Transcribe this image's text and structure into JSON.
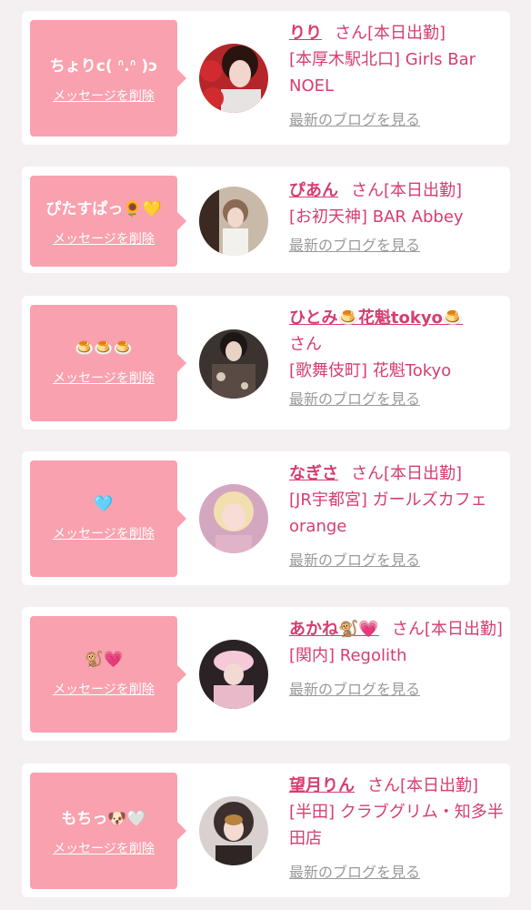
{
  "delete_label": "メッセージを削除",
  "blog_label": "最新のブログを見る",
  "san_label": "さん",
  "colors": {
    "background": "#f4f0f1",
    "bubble": "#f9a1ae",
    "accent": "#d63d72",
    "muted": "#9a9a9a"
  },
  "messages": [
    {
      "message": "ちょりc( ᐢ.ᐢ )ɔ",
      "name": "りり",
      "line1": "[本日出勤]",
      "line2": "[本厚木駅北口] Girls Bar NOEL",
      "avatar_icon": "woman-with-red-decoration-photo"
    },
    {
      "message": "ぴたすぱっ🌻💛",
      "name": "ぴあん",
      "line1": "[本日出勤]",
      "line2": "[お初天神] BAR Abbey",
      "avatar_icon": "woman-mirror-selfie-photo"
    },
    {
      "message": "🍮🍮🍮",
      "name": "ひとみ🍮花魁tokyo🍮",
      "line1": "",
      "line2": "[歌舞伎町] 花魁Tokyo",
      "avatar_icon": "woman-in-kimono-photo"
    },
    {
      "message": "🩵",
      "name": "なぎさ",
      "line1": "[本日出勤]",
      "line2": "[JR宇都宮] ガールズカフェ orange",
      "avatar_icon": "blonde-woman-photo"
    },
    {
      "message": "🐒💗",
      "name": "あかね🐒💗",
      "line1": "[本日出勤]",
      "line2": "[関内] Regolith",
      "avatar_icon": "woman-pink-hat-photo"
    },
    {
      "message": "もちっ🐶🤍",
      "name": "望月りん",
      "line1": "[本日出勤]",
      "line2": "[半田] クラブグリム・知多半田店",
      "avatar_icon": "woman-with-dog-filter-photo"
    }
  ]
}
